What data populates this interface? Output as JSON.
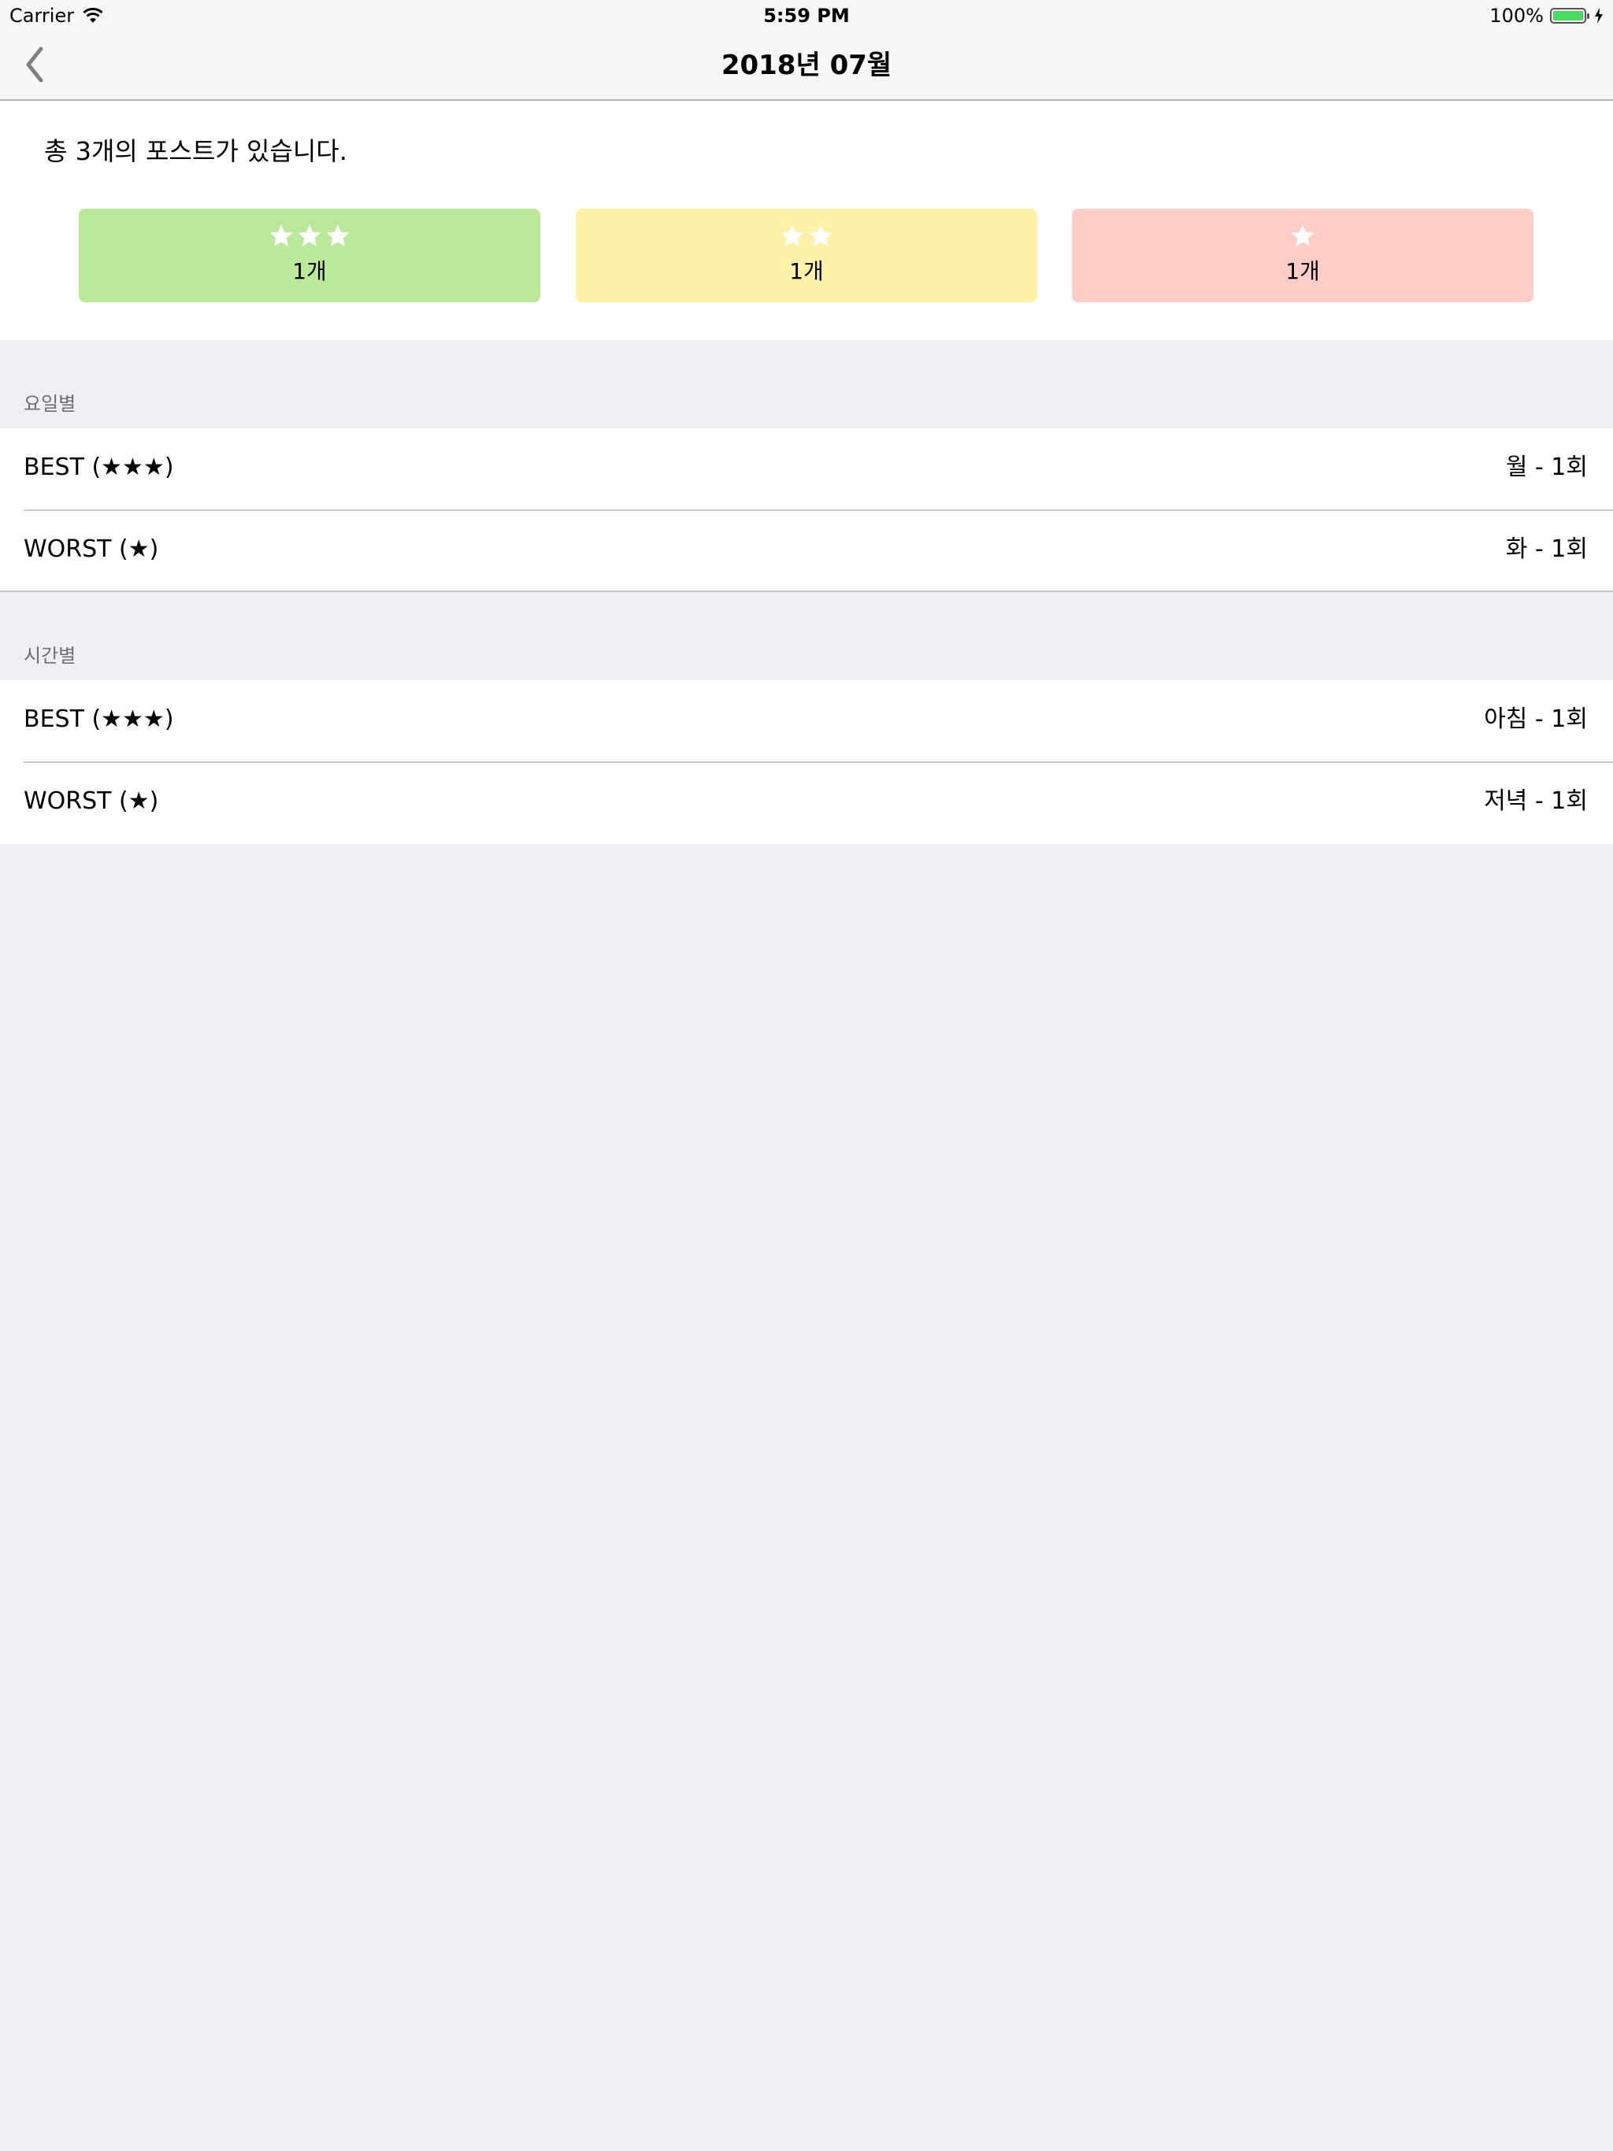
{
  "status_bar": {
    "carrier": "Carrier",
    "time": "5:59 PM",
    "battery_percent": "100%",
    "battery_level": 1.0
  },
  "nav": {
    "title": "2018년 07월",
    "back_icon": "chevron-left-icon"
  },
  "summary": {
    "text": "총 3개의 포스트가 있습니다.",
    "cards": [
      {
        "stars": 3,
        "count": "1개",
        "color": "#bbe89a"
      },
      {
        "stars": 2,
        "count": "1개",
        "color": "#fff1a8"
      },
      {
        "stars": 1,
        "count": "1개",
        "color": "#ffcdc8"
      }
    ]
  },
  "sections": [
    {
      "header": "요일별",
      "rows": [
        {
          "label": "BEST (★★★)",
          "value": "월 - 1회"
        },
        {
          "label": "WORST (★)",
          "value": "화 - 1회"
        }
      ]
    },
    {
      "header": "시간별",
      "rows": [
        {
          "label": "BEST (★★★)",
          "value": "아침 - 1회"
        },
        {
          "label": "WORST (★)",
          "value": "저녁 - 1회"
        }
      ]
    }
  ],
  "colors": {
    "background": "#efeff4",
    "battery": "#4cd964",
    "section_header": "#6d6d72"
  }
}
